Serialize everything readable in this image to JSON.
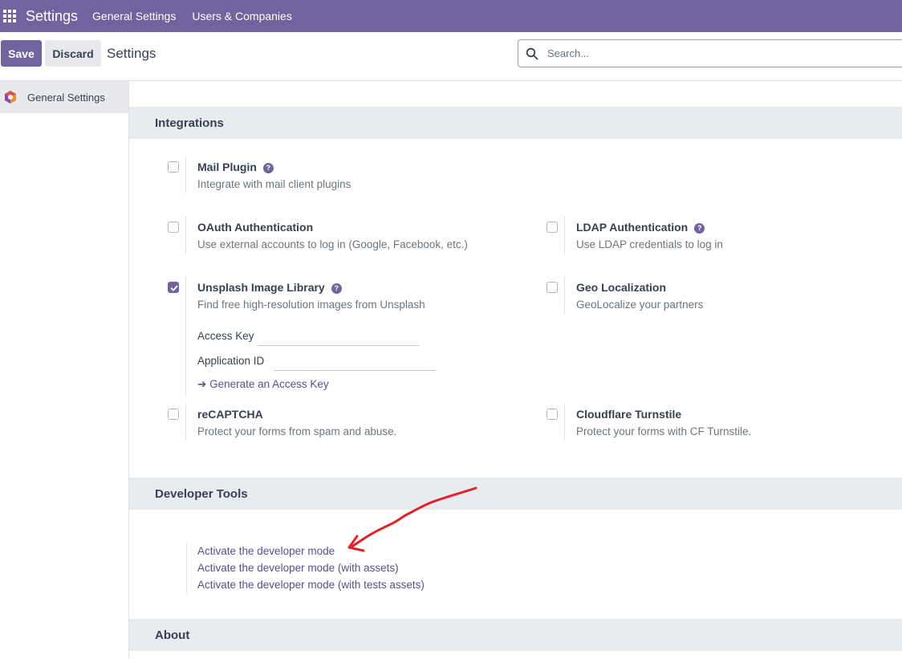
{
  "topnav": {
    "app_name": "Settings",
    "links": [
      "General Settings",
      "Users & Companies"
    ]
  },
  "control_panel": {
    "save_label": "Save",
    "discard_label": "Discard",
    "breadcrumb": "Settings",
    "search_placeholder": "Search..."
  },
  "sidebar": {
    "items": [
      {
        "label": "General Settings"
      }
    ]
  },
  "integrations": {
    "title": "Integrations",
    "settings": [
      {
        "title": "Mail Plugin",
        "desc": "Integrate with mail client plugins",
        "checked": false
      },
      {
        "title": "OAuth Authentication",
        "desc": "Use external accounts to log in (Google, Facebook, etc.)",
        "checked": false
      },
      {
        "title": "LDAP Authentication",
        "desc": "Use LDAP credentials to log in",
        "checked": false
      },
      {
        "title": "Unsplash Image Library",
        "desc": "Find free high-resolution images from Unsplash",
        "checked": true
      },
      {
        "title": "Geo Localization",
        "desc": "GeoLocalize your partners",
        "checked": false
      },
      {
        "title": "reCAPTCHA",
        "desc": "Protect your forms from spam and abuse.",
        "checked": false
      },
      {
        "title": "Cloudflare Turnstile",
        "desc": "Protect your forms with CF Turnstile.",
        "checked": false
      }
    ],
    "unsplash": {
      "access_key_label": "Access Key",
      "application_id_label": "Application ID",
      "generate_link": "Generate an Access Key",
      "arrow_glyph": "➔"
    }
  },
  "developer_tools": {
    "title": "Developer Tools",
    "links": [
      "Activate the developer mode",
      "Activate the developer mode (with assets)",
      "Activate the developer mode (with tests assets)"
    ]
  },
  "about": {
    "title": "About"
  },
  "help_glyph": "?",
  "colors": {
    "brand": "#71639e",
    "link": "#5c4e8a",
    "annotation": "#e0232a"
  }
}
